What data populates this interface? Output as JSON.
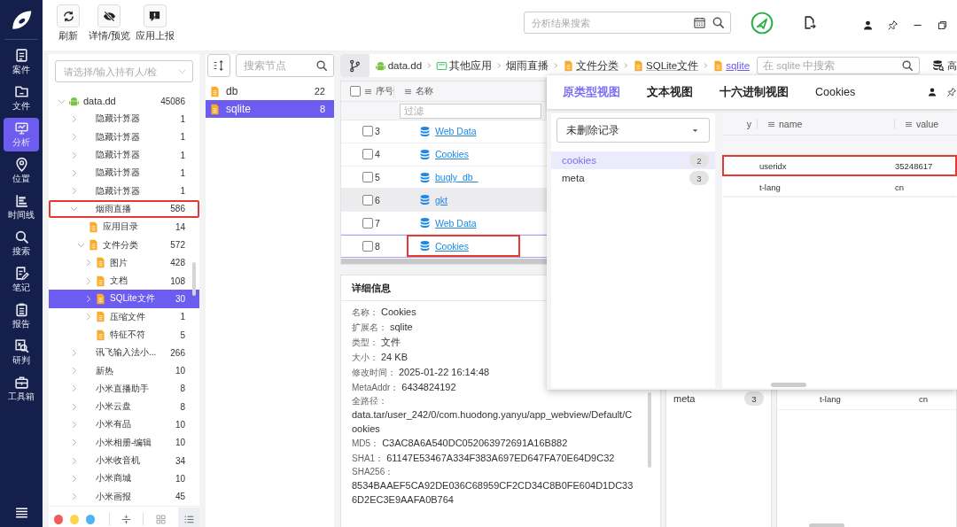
{
  "nav": {
    "items": [
      {
        "label": "案件",
        "selected": false
      },
      {
        "label": "文件",
        "selected": false
      },
      {
        "label": "分析",
        "selected": true
      },
      {
        "label": "位置",
        "selected": false
      },
      {
        "label": "时间线",
        "selected": false
      },
      {
        "label": "搜索",
        "selected": false
      },
      {
        "label": "笔记",
        "selected": false
      },
      {
        "label": "报告",
        "selected": false
      },
      {
        "label": "研判",
        "selected": false
      },
      {
        "label": "工具箱",
        "selected": false
      }
    ]
  },
  "toolbar": {
    "buttons": [
      {
        "label": "刷新"
      },
      {
        "label": "详情/预览"
      },
      {
        "label": "应用上报"
      }
    ],
    "search": {
      "placeholder": "分析结果搜索"
    }
  },
  "tree_panel": {
    "owner_select": {
      "placeholder": "请选择/输入持有人/检"
    },
    "tree": [
      {
        "label": "data.dd",
        "count": "45086",
        "kind": "device",
        "expanded": true,
        "selected": false,
        "marked": false,
        "children": [
          {
            "label": "隐藏计算器",
            "count": "1",
            "kind": "app",
            "expanded": false,
            "selected": false,
            "marked": false
          },
          {
            "label": "隐藏计算器",
            "count": "1",
            "kind": "app",
            "expanded": false,
            "selected": false,
            "marked": false
          },
          {
            "label": "隐藏计算器",
            "count": "1",
            "kind": "app",
            "expanded": false,
            "selected": false,
            "marked": false
          },
          {
            "label": "隐藏计算器",
            "count": "1",
            "kind": "app",
            "expanded": false,
            "selected": false,
            "marked": false
          },
          {
            "label": "隐藏计算器",
            "count": "1",
            "kind": "app",
            "expanded": false,
            "selected": false,
            "marked": false
          },
          {
            "label": "烟雨直播",
            "count": "586",
            "kind": "app",
            "expanded": true,
            "selected": false,
            "marked": true,
            "children": [
              {
                "label": "应用目录",
                "count": "14",
                "kind": "category",
                "selected": false,
                "marked": false
              },
              {
                "label": "文件分类",
                "count": "572",
                "kind": "category",
                "expanded": true,
                "selected": false,
                "marked": false,
                "children": [
                  {
                    "label": "图片",
                    "count": "428",
                    "kind": "category",
                    "expanded": false,
                    "selected": false,
                    "marked": false
                  },
                  {
                    "label": "文档",
                    "count": "108",
                    "kind": "category",
                    "expanded": false,
                    "selected": false,
                    "marked": false
                  },
                  {
                    "label": "SQLite文件",
                    "count": "30",
                    "kind": "category",
                    "expanded": false,
                    "selected": true,
                    "marked": false
                  },
                  {
                    "label": "压缩文件",
                    "count": "1",
                    "kind": "category",
                    "expanded": false,
                    "selected": false,
                    "marked": false
                  },
                  {
                    "label": "特征不符",
                    "count": "5",
                    "kind": "category",
                    "selected": false,
                    "marked": false
                  }
                ]
              }
            ]
          },
          {
            "label": "讯飞输入法小...",
            "count": "266",
            "kind": "app",
            "expanded": false,
            "selected": false,
            "marked": false
          },
          {
            "label": "新热",
            "count": "10",
            "kind": "app",
            "expanded": false,
            "selected": false,
            "marked": false
          },
          {
            "label": "小米直播助手",
            "count": "8",
            "kind": "app",
            "expanded": false,
            "selected": false,
            "marked": false
          },
          {
            "label": "小米云盘",
            "count": "8",
            "kind": "app",
            "expanded": false,
            "selected": false,
            "marked": false
          },
          {
            "label": "小米有品",
            "count": "10",
            "kind": "app",
            "expanded": false,
            "selected": false,
            "marked": false
          },
          {
            "label": "小米相册-编辑",
            "count": "10",
            "kind": "app",
            "expanded": false,
            "selected": false,
            "marked": false
          },
          {
            "label": "小米收音机",
            "count": "34",
            "kind": "app",
            "expanded": false,
            "selected": false,
            "marked": false
          },
          {
            "label": "小米商城",
            "count": "10",
            "kind": "app",
            "expanded": false,
            "selected": false,
            "marked": false
          },
          {
            "label": "小米画报",
            "count": "45",
            "kind": "app",
            "expanded": false,
            "selected": false,
            "marked": false
          }
        ]
      }
    ],
    "color_filters": [
      {
        "color": "#f25a5a"
      },
      {
        "color": "#fdd34d"
      },
      {
        "color": "#4db3f5"
      }
    ],
    "view_modes": [
      {
        "selected": false
      },
      {
        "selected": true
      }
    ]
  },
  "node_panel": {
    "search": {
      "placeholder": "搜索节点"
    },
    "items": [
      {
        "label": "db",
        "count": "22",
        "selected": false
      },
      {
        "label": "sqlite",
        "count": "8",
        "selected": true
      }
    ]
  },
  "breadcrumb": [
    {
      "label": "data.dd",
      "kind": "device",
      "current": false
    },
    {
      "label": "其他应用",
      "kind": "app",
      "current": false
    },
    {
      "label": "烟雨直播",
      "kind": "plain",
      "current": false
    },
    {
      "label": "文件分类",
      "kind": "file",
      "current": false
    },
    {
      "label": "SQLite文件",
      "kind": "file",
      "current": false
    },
    {
      "label": "sqlite",
      "kind": "file",
      "current": true
    }
  ],
  "content_search": {
    "placeholder": "在 sqlite 中搜索"
  },
  "advanced_search": {
    "label": "高"
  },
  "file_table": {
    "select_all_checked": false,
    "columns": [
      "序号",
      "名称"
    ],
    "filter_placeholder": "过滤",
    "rows": [
      {
        "index": "3",
        "name": "Web Data",
        "checked": false,
        "selected": false,
        "highlighted": false,
        "marked": false
      },
      {
        "index": "4",
        "name": "Cookies",
        "checked": false,
        "selected": false,
        "highlighted": false,
        "marked": false
      },
      {
        "index": "5",
        "name": "bugly_db_",
        "checked": false,
        "selected": false,
        "highlighted": false,
        "marked": false
      },
      {
        "index": "6",
        "name": "gkt",
        "checked": false,
        "selected": false,
        "highlighted": true,
        "marked": false
      },
      {
        "index": "7",
        "name": "Web Data",
        "checked": false,
        "selected": false,
        "highlighted": false,
        "marked": false
      },
      {
        "index": "8",
        "name": "Cookies",
        "checked": false,
        "selected": true,
        "highlighted": false,
        "marked": true
      }
    ]
  },
  "details": {
    "title": "详细信息",
    "fields": [
      {
        "label": "名称：",
        "value": "Cookies",
        "kind": "inline"
      },
      {
        "label": "扩展名：",
        "value": "sqlite",
        "kind": "inline"
      },
      {
        "label": "类型：",
        "value": "文件",
        "kind": "inline"
      },
      {
        "label": "大小：",
        "value": "24 KB",
        "kind": "inline"
      },
      {
        "label": "修改时间：",
        "value": "2025-01-22 16:14:48",
        "kind": "inline"
      },
      {
        "label": "MetaAddr：",
        "value": "6434824192",
        "kind": "inline"
      },
      {
        "label": "全路径：",
        "value": "data.tar/user_242/0/com.huodong.yanyu/app_webview/Default/Cookies",
        "kind": "block"
      },
      {
        "label": "MD5：",
        "value": "C3AC8A6A540DC052063972691A16B882",
        "kind": "inline"
      },
      {
        "label": "SHA1：",
        "value": "61147E53467A334F383A697ED647FA70E64D9C32",
        "kind": "inline"
      },
      {
        "label": "SHA256：",
        "value": "8534BAAEF5CA92DE036C68959CF2CD34C8B0FE604D1DC336D2EC3E9AAFA0B764",
        "kind": "block"
      }
    ]
  },
  "viewer": {
    "tabs": [
      {
        "label": "原类型视图",
        "selected": true
      },
      {
        "label": "文本视图",
        "selected": false
      },
      {
        "label": "十六进制视图",
        "selected": false
      },
      {
        "label": "Cookies",
        "selected": false
      }
    ],
    "record_select": {
      "value": "未删除记录"
    },
    "tables": [
      {
        "name": "cookies",
        "count": "2",
        "selected": true
      },
      {
        "name": "meta",
        "count": "3",
        "selected": false
      }
    ],
    "grid": {
      "columns": [
        "y",
        "name",
        "value"
      ],
      "rows": [
        {
          "name": "useridx",
          "value": "35248617",
          "marked": true
        },
        {
          "name": "t-lang",
          "value": "cn",
          "marked": false
        }
      ]
    }
  },
  "background_viewer": {
    "tables": [
      {
        "name": "meta",
        "count": "3"
      }
    ],
    "rows": [
      {
        "name": "t-lang",
        "value": "cn"
      }
    ]
  }
}
